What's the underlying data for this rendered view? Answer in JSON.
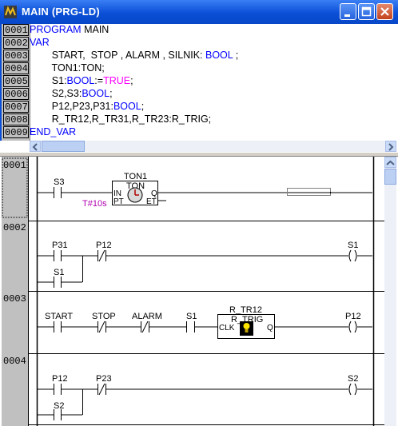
{
  "window": {
    "title": "MAIN (PRG-LD)"
  },
  "declaration": {
    "lines": [
      {
        "num": "0001",
        "parts": [
          {
            "t": "PROGRAM",
            "c": "kw"
          },
          {
            "t": " MAIN",
            "c": ""
          }
        ]
      },
      {
        "num": "0002",
        "parts": [
          {
            "t": "VAR",
            "c": "kw"
          }
        ]
      },
      {
        "num": "0003",
        "parts": [
          {
            "t": "        START,  STOP , ALARM , SILNIK: ",
            "c": ""
          },
          {
            "t": "BOOL",
            "c": "kw"
          },
          {
            "t": " ;",
            "c": ""
          }
        ]
      },
      {
        "num": "0004",
        "parts": [
          {
            "t": "        TON1:TON;",
            "c": ""
          }
        ]
      },
      {
        "num": "0005",
        "parts": [
          {
            "t": "        S1:",
            "c": ""
          },
          {
            "t": "BOOL",
            "c": "kw"
          },
          {
            "t": ":=",
            "c": ""
          },
          {
            "t": "TRUE",
            "c": "pn"
          },
          {
            "t": ";",
            "c": ""
          }
        ]
      },
      {
        "num": "0006",
        "parts": [
          {
            "t": "        S2,S3:",
            "c": ""
          },
          {
            "t": "BOOL",
            "c": "kw"
          },
          {
            "t": ";",
            "c": ""
          }
        ]
      },
      {
        "num": "0007",
        "parts": [
          {
            "t": "        P12,P23,P31:",
            "c": ""
          },
          {
            "t": "BOOL",
            "c": "kw"
          },
          {
            "t": ";",
            "c": ""
          }
        ]
      },
      {
        "num": "0008",
        "parts": [
          {
            "t": "        R_TR12,R_TR31,R_TR23:R_TRIG;",
            "c": ""
          }
        ]
      },
      {
        "num": "0009",
        "parts": [
          {
            "t": "END_VAR",
            "c": "kw"
          }
        ]
      }
    ]
  },
  "networks": [
    {
      "num": "0001",
      "contact": "S3",
      "block_instance": "TON1",
      "block_type": "TON",
      "in_label": "IN",
      "pt_label": "PT",
      "q_label": "Q",
      "et_label": "ET",
      "pt_value": "T#10s"
    },
    {
      "num": "0002",
      "contact_a": "P31",
      "contact_b": "P12",
      "contact_c": "S1",
      "coil": "S1"
    },
    {
      "num": "0003",
      "c1": "START",
      "c2": "STOP",
      "c3": "ALARM",
      "c4": "S1",
      "block_instance": "R_TR12",
      "block_type": "R_TRIG",
      "clk_label": "CLK",
      "q_label": "Q",
      "coil": "P12"
    },
    {
      "num": "0004",
      "contact_a": "P12",
      "contact_b": "P23",
      "contact_c": "S2",
      "coil": "S2"
    }
  ],
  "icons": [
    "app-icon",
    "minimize-icon",
    "maximize-icon",
    "close-icon",
    "scroll-left-icon",
    "scroll-right-icon",
    "scroll-up-icon",
    "timer-icon",
    "bulb-icon"
  ]
}
